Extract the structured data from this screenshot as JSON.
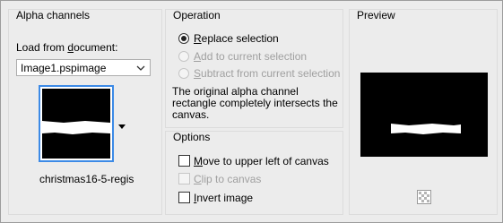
{
  "alpha": {
    "group_title": "Alpha channels",
    "load_label_pre": "Load from ",
    "load_label_key": "d",
    "load_label_post": "ocument:",
    "document_value": "Image1.pspimage",
    "channel_name": "christmas16-5-regis"
  },
  "operation": {
    "group_title": "Operation",
    "options": [
      {
        "key": "R",
        "rest": "eplace selection",
        "selected": true,
        "enabled": true
      },
      {
        "key": "A",
        "rest": "dd to current selection",
        "selected": false,
        "enabled": false
      },
      {
        "key": "S",
        "rest": "ubtract from current selection",
        "selected": false,
        "enabled": false
      }
    ],
    "description": "The original alpha channel\nrectangle completely intersects the\ncanvas."
  },
  "options": {
    "group_title": "Options",
    "items": [
      {
        "key": "M",
        "rest": "ove to upper left of canvas",
        "checked": false,
        "enabled": true
      },
      {
        "key": "C",
        "rest": "lip to canvas",
        "checked": false,
        "enabled": false
      },
      {
        "key": "I",
        "rest": "nvert image",
        "checked": false,
        "enabled": true
      }
    ]
  },
  "preview": {
    "group_title": "Preview",
    "bg_icon": "checkerboard-icon"
  },
  "colors": {
    "accent": "#3c8ae6",
    "preview_bg": "#000000",
    "disabled_text": "#a0a0a0"
  }
}
